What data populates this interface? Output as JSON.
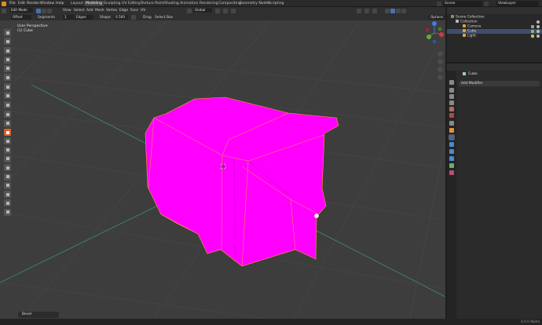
{
  "topbar": {
    "menus": [
      "File",
      "Edit",
      "Render",
      "Window",
      "Help"
    ],
    "workspaces": [
      "Layout",
      "Modeling",
      "Sculpting",
      "UV Editing",
      "Texture Paint",
      "Shading",
      "Animation",
      "Rendering",
      "Compositing",
      "Geometry Nodes",
      "Scripting"
    ],
    "active_workspace": "Modeling",
    "scene_name": "Scene",
    "view_layer": "ViewLayer"
  },
  "viewport_header": {
    "mode": "Edit Mode",
    "menus": [
      "View",
      "Select",
      "Add",
      "Mesh",
      "Vertex",
      "Edge",
      "Face",
      "UV"
    ],
    "orientation": "Global",
    "options_label": "Options"
  },
  "operator_header": {
    "operator": "Offset",
    "segments_label": "Segments",
    "segments_value": "1",
    "affect_value": "Edges",
    "shape_label": "Shape",
    "shape_value": "0.500",
    "drag_label": "Drag",
    "select_box_label": "Select Box"
  },
  "viewport_overlay": {
    "view_name": "User Perspective",
    "object_label": "(1) Cube"
  },
  "colors": {
    "mesh_face": "#ff00ff",
    "mesh_edge": "#ff9a3c",
    "active_mode": "#d6612a",
    "selection": "#4772b3"
  },
  "gizmo": {
    "axes": [
      "X",
      "Y",
      "Z"
    ]
  },
  "toolbar": {
    "tools": [
      "select-box",
      "cursor",
      "move",
      "rotate",
      "scale",
      "transform",
      "annotate",
      "measure",
      "add-cube",
      "extrude",
      "inset",
      "bevel",
      "loop-cut",
      "knife",
      "poly-build",
      "spin",
      "smooth",
      "edge-slide",
      "shrink-fatten",
      "shear",
      "rip"
    ],
    "active_tool": "bevel"
  },
  "last_operation": "Bevel",
  "outliner": {
    "collection_root": "Scene Collection",
    "collection": "Collection",
    "items": [
      {
        "name": "Camera",
        "color": "#e0a040"
      },
      {
        "name": "Cube",
        "color": "#e0a040",
        "selected": true
      },
      {
        "name": "Light",
        "color": "#e0a040"
      }
    ]
  },
  "properties": {
    "object_name": "Cube",
    "add_modifier_label": "Add Modifier",
    "active_tab": "modifiers"
  },
  "status": {
    "version": "4.0.0 Alpha"
  }
}
